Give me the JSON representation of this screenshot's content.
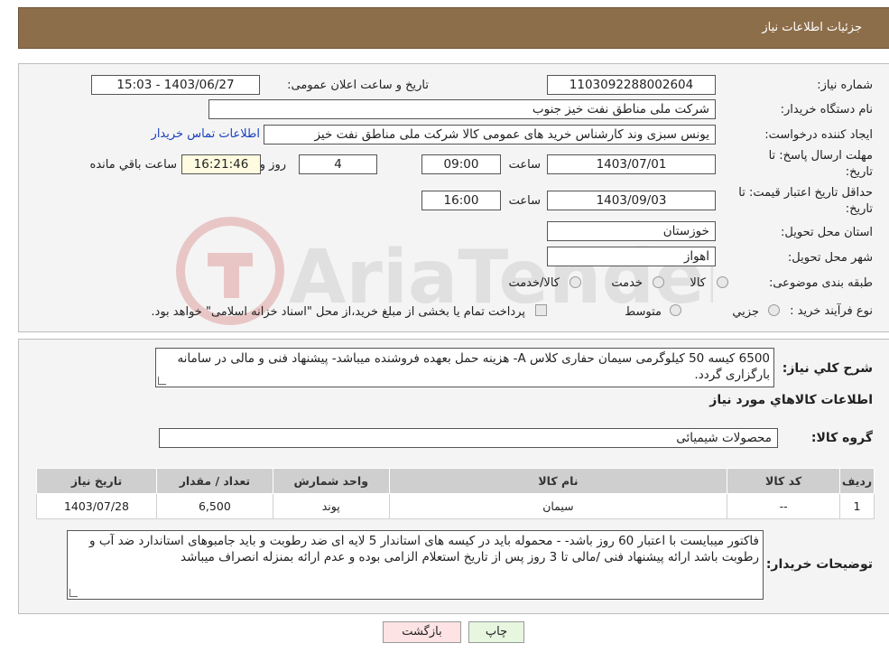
{
  "header": {
    "title": "جزئیات اطلاعات نیاز"
  },
  "fields": {
    "need_number_label": "شماره نیاز:",
    "need_number": "1103092288002604",
    "announce_label": "تاریخ و ساعت اعلان عمومی:",
    "announce_value": "1403/06/27 - 15:03",
    "buyer_org_label": "نام دستگاه خریدار:",
    "buyer_org": "شرکت ملی مناطق نفت خیز جنوب",
    "creator_label": "ایجاد کننده درخواست:",
    "creator": "یونس سبزی وند کارشناس خرید های عمومی کالا شرکت ملی مناطق نفت خیز",
    "contact_link": "اطلاعات تماس خریدار",
    "deadline_label_1": "مهلت ارسال پاسخ: تا",
    "deadline_label_2": "تاریخ:",
    "deadline_date": "1403/07/01",
    "time_label": "ساعت",
    "deadline_time": "09:00",
    "days_value": "4",
    "days_label": "روز و",
    "remaining_time": "16:21:46",
    "remaining_label": "ساعت باقي مانده",
    "validity_label_1": "حداقل تاریخ اعتبار قیمت: تا",
    "validity_label_2": "تاریخ:",
    "validity_date": "1403/09/03",
    "validity_time": "16:00",
    "province_label": "استان محل تحویل:",
    "province": "خوزستان",
    "city_label": "شهر محل تحویل:",
    "city": "اهواز",
    "category_label": "طبقه بندی موضوعی:",
    "category_options": [
      "کالا",
      "خدمت",
      "کالا/خدمت"
    ],
    "process_label": "نوع فرآیند خرید :",
    "process_options": [
      "جزيي",
      "متوسط"
    ],
    "process_note": "پرداخت تمام یا بخشی از مبلغ خرید،از محل \"اسناد خزانه اسلامی\" خواهد بود."
  },
  "watermark": {
    "text": "AriaTender.neT"
  },
  "description": {
    "label": "شرح کلي نياز:",
    "text": "6500 کیسه 50 کیلوگرمی سیمان حفاری کلاس  A- هزینه حمل بعهده فروشنده میباشد- پیشنهاد فنی و مالی در سامانه بارگزاری گردد."
  },
  "goods_info_title": "اطلاعات کالاهاي مورد نياز",
  "goods_group": {
    "label": "گروه کالا:",
    "value": "محصولات شیمیائی"
  },
  "table": {
    "headers": [
      "رديف",
      "کد کالا",
      "نام کالا",
      "واحد شمارش",
      "تعداد / مقدار",
      "تاریخ نیاز"
    ],
    "rows": [
      {
        "row": "1",
        "code": "--",
        "name": "سیمان",
        "unit": "پوند",
        "qty": "6,500",
        "date": "1403/07/28"
      }
    ]
  },
  "buyer_notes": {
    "label": "توضیحات خریدار:",
    "text": "فاکتور میبایست با اعتبار 60 روز باشد- - محموله باید در کیسه های استاندار 5 لایه ای ضد رطوبت و باید جامبوهای استاندارد ضد آب و رطوبت باشد ارائه پیشنهاد فنی /مالی تا 3 روز پس از تاریخ استعلام الزامی بوده و عدم ارائه بمنزله انصراف میباشد"
  },
  "buttons": {
    "print": "چاپ",
    "back": "بازگشت"
  },
  "colors": {
    "header_bg": "#8d6e4a",
    "link": "#1a3fbf",
    "back_button_bg": "#fde3e3",
    "print_button_bg": "#e6f6df"
  }
}
